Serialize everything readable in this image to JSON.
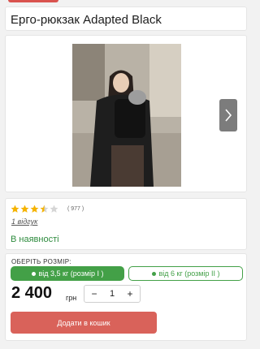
{
  "product": {
    "title": "Ерго-рюкзак Adapted Black",
    "rating": 3.5,
    "rating_max": 5,
    "rating_count": "( 977 )",
    "reviews_link": "1 відгук",
    "availability": "В наявності"
  },
  "options": {
    "label": "ОБЕРІТЬ РОЗМІР:",
    "items": [
      {
        "label": "від 3,5 кг (розмір I )",
        "selected": true
      },
      {
        "label": "від 6 кг (розмір II )",
        "selected": false
      }
    ]
  },
  "price": {
    "amount": "2 400",
    "currency": "грн"
  },
  "quantity": {
    "minus": "−",
    "value": "1",
    "plus": "+"
  },
  "cart_button": "Додати в кошик",
  "colors": {
    "accent": "#d9534f",
    "green": "#43a047",
    "cart": "#d9625a",
    "star": "#f5b301"
  },
  "icons": {
    "next": "chevron-right-icon",
    "star": "star-icon"
  }
}
